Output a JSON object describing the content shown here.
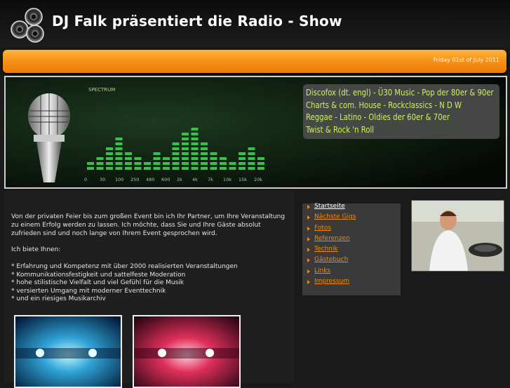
{
  "header": {
    "title": "DJ Falk präsentiert die Radio - Show",
    "logo_icon": "speakers-icon",
    "date": "Friday 01st of July 2011"
  },
  "banner": {
    "spectrum_label": "SPECTRUM",
    "freq_labels": [
      "0",
      "30",
      "100",
      "250",
      "480",
      "600",
      "2k",
      "4k",
      "7k",
      "10k",
      "15k",
      "20k"
    ],
    "genres": [
      "Discofox (dt. engl) - Ü30 Music - Pop der 80er & 90er",
      "Charts & com. House - Rockclassics - N D W",
      "Reggae - Latino - Oldies der 60er & 70er",
      "Twist & Rock 'n Roll"
    ],
    "colors": {
      "text": "#c9f25e",
      "bars": "#36c24a"
    }
  },
  "content": {
    "intro": "Von der privaten Feier bis zum großen Event bin ich Ihr Partner, um Ihre Veranstaltung zu einem Erfolg werden zu lassen. Ich möchte, dass Sie und Ihre Gäste absolut zufrieden sind und noch lange von Ihrem Event gesprochen wird.",
    "offer_title": "Ich biete Ihnen:",
    "offers": [
      "* Erfahrung und Kompetenz mit über 2000 realisierten Veranstaltungen",
      "* Kommunikationsfestigkeit und sattelfeste Moderation",
      "* hohe stilistische Vielfalt und viel Gefühl für die Musik",
      "* versierten Umgang mit moderner Eventtechnik",
      "* und ein riesiges Musikarchiv"
    ]
  },
  "nav": {
    "items": [
      "Startseite",
      "Nächste Gigs",
      "Fotos",
      "Referenzen",
      "Technik",
      "Gästebuch",
      "Links",
      "Impressum"
    ],
    "active": "Startseite",
    "colors": {
      "link": "#f08a0d",
      "active": "#ffffff"
    }
  }
}
